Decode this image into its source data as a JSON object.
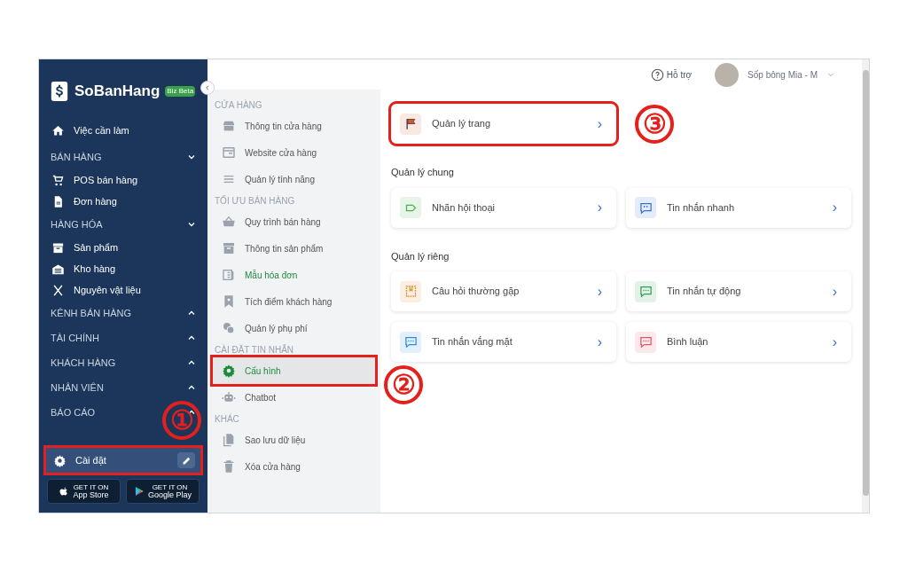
{
  "sidebar": {
    "logo": "SoBanHang",
    "logo_badge": "Biz Beta",
    "items": [
      {
        "kind": "link",
        "label": "Việc cần làm"
      },
      {
        "kind": "section",
        "label": "BÁN HÀNG",
        "expanded": true
      },
      {
        "kind": "link",
        "label": "POS bán hàng"
      },
      {
        "kind": "link",
        "label": "Đơn hàng"
      },
      {
        "kind": "section",
        "label": "HÀNG HÓA",
        "expanded": true
      },
      {
        "kind": "link",
        "label": "Sản phẩm"
      },
      {
        "kind": "link",
        "label": "Kho hàng"
      },
      {
        "kind": "link",
        "label": "Nguyên vật liệu"
      },
      {
        "kind": "section",
        "label": "KÊNH BÁN HÀNG",
        "expanded": false
      },
      {
        "kind": "section",
        "label": "TÀI CHÍNH",
        "expanded": false
      },
      {
        "kind": "section",
        "label": "KHÁCH HÀNG",
        "expanded": false
      },
      {
        "kind": "section",
        "label": "NHÂN VIÊN",
        "expanded": false
      },
      {
        "kind": "section",
        "label": "BÁO CÁO",
        "expanded": false
      }
    ],
    "settings": {
      "label": "Cài đặt",
      "marked": true,
      "annotation": "①"
    },
    "stores": [
      {
        "small": "GET IT ON",
        "label": "App Store"
      },
      {
        "small": "GET IT ON",
        "label": "Google Play"
      }
    ]
  },
  "header": {
    "help": "Hỗ trợ",
    "user": "Sốp bông Mia - M"
  },
  "settings_menu": [
    {
      "heading": "CỬA HÀNG",
      "items": [
        {
          "label": "Thông tin cửa hàng",
          "selected": false,
          "highlighted": false,
          "marked": false
        },
        {
          "label": "Website cửa hàng",
          "selected": false,
          "highlighted": false,
          "marked": false
        },
        {
          "label": "Quản lý tính năng",
          "selected": false,
          "highlighted": false,
          "marked": false
        }
      ]
    },
    {
      "heading": "TỐI ƯU BÁN HÀNG",
      "items": [
        {
          "label": "Quy trình bán hàng",
          "selected": false,
          "highlighted": false,
          "marked": false
        },
        {
          "label": "Thông tin sản phẩm",
          "selected": false,
          "highlighted": false,
          "marked": false
        },
        {
          "label": "Mẫu hóa đơn",
          "selected": false,
          "highlighted": true,
          "marked": false
        },
        {
          "label": "Tích điểm khách hàng",
          "selected": false,
          "highlighted": false,
          "marked": false
        },
        {
          "label": "Quản lý phụ phí",
          "selected": false,
          "highlighted": false,
          "marked": false
        }
      ]
    },
    {
      "heading": "CÀI ĐẶT TIN NHẮN",
      "items": [
        {
          "label": "Cấu hình",
          "selected": true,
          "highlighted": false,
          "marked": true,
          "annotation": "②"
        },
        {
          "label": "Chatbot",
          "selected": false,
          "highlighted": false,
          "marked": false
        }
      ]
    },
    {
      "heading": "KHÁC",
      "items": [
        {
          "label": "Sao lưu dữ liệu",
          "selected": false,
          "highlighted": false,
          "marked": false
        },
        {
          "label": "Xóa cửa hàng",
          "selected": false,
          "highlighted": false,
          "marked": false
        }
      ]
    }
  ],
  "content": {
    "top_card": {
      "label": "Quản lý trang",
      "color": "#d9542b",
      "marked": true,
      "annotation": "③",
      "arrow": "›"
    },
    "groups": [
      {
        "title": "Quản lý chung",
        "cards": [
          {
            "label": "Nhãn hội thoại",
            "color": "#4caf50",
            "arrow": "›"
          },
          {
            "label": "Tin nhắn nhanh",
            "color": "#3b6fd1",
            "arrow": "›"
          }
        ]
      },
      {
        "title": "Quản lý riêng",
        "cards": [
          {
            "label": "Câu hỏi thường gặp",
            "color": "#e08a2a",
            "arrow": "›"
          },
          {
            "label": "Tin nhắn tự động",
            "color": "#2e9e5a",
            "arrow": "›"
          },
          {
            "label": "Tin nhắn vắng mặt",
            "color": "#2a8ee0",
            "arrow": "›"
          },
          {
            "label": "Bình luận",
            "color": "#e0566a",
            "arrow": "›"
          }
        ]
      }
    ]
  }
}
